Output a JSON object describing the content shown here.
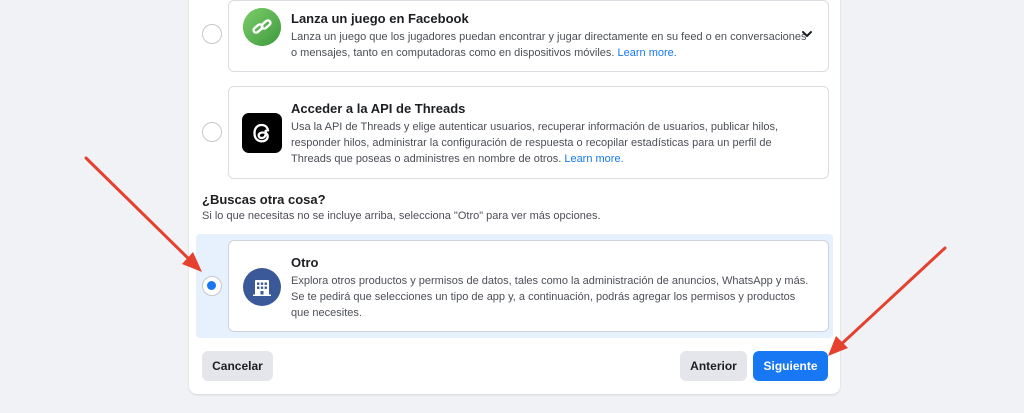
{
  "options": [
    {
      "title": "Lanza un juego en Facebook",
      "desc": "Lanza un juego que los jugadores puedan encontrar y jugar directamente en su feed o en conversaciones o mensajes, tanto en computadoras como en dispositivos móviles.",
      "link": "Learn more.",
      "icon": "game-link-icon",
      "selected": false
    },
    {
      "title": "Acceder a la API de Threads",
      "desc": "Usa la API de Threads y elige autenticar usuarios, recuperar información de usuarios, publicar hilos, responder hilos, administrar la configuración de respuesta o recopilar estadísticas para un perfil de Threads que poseas o administres en nombre de otros.",
      "link": "Learn more.",
      "icon": "threads-icon",
      "selected": false
    }
  ],
  "other_section": {
    "title": "¿Buscas otra cosa?",
    "subtitle": "Si lo que necesitas no se incluye arriba, selecciona \"Otro\" para ver más opciones."
  },
  "other_option": {
    "title": "Otro",
    "desc": "Explora otros productos y permisos de datos, tales como la administración de anuncios, WhatsApp y más. Se te pedirá que selecciones un tipo de app y, a continuación, podrás agregar los permisos y productos que necesites.",
    "icon": "building-icon",
    "selected": true
  },
  "footer": {
    "cancel_label": "Cancelar",
    "back_label": "Anterior",
    "next_label": "Siguiente"
  },
  "colors": {
    "accent": "#1877f2",
    "selected_bg": "#e7f0fd",
    "annotation_arrow": "#e4412f"
  }
}
